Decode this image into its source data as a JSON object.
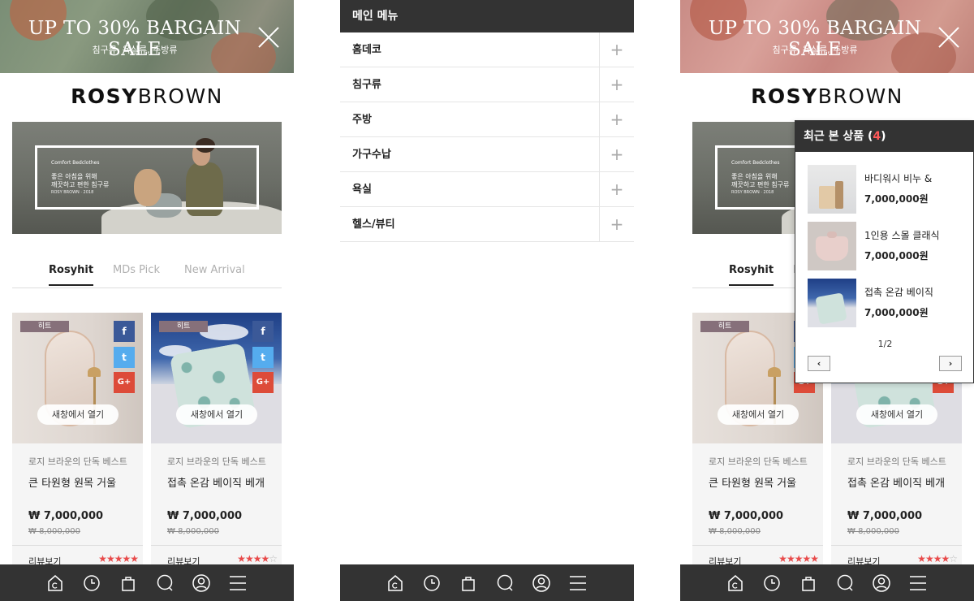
{
  "promo": {
    "title": "UP TO 30% BARGAIN SALE",
    "subtitle": "침구류, 욕실류, 주방류"
  },
  "logo": {
    "bold": "ROSY",
    "light": "BROWN"
  },
  "hero": {
    "small": "Comfort Bedclothes",
    "line1": "좋은 아침을 위해",
    "line2": "깨끗하고 편한 침구류",
    "tiny": "ROSY BROWN · 2018"
  },
  "tabs": [
    {
      "label": "Rosyhit"
    },
    {
      "label": "MDs Pick"
    },
    {
      "label": "New Arrival"
    }
  ],
  "products": [
    {
      "badge": "히트",
      "tag": "로지 브라운의 단독 베스트",
      "name": "큰 타원형 원목 거울",
      "price": "₩ 7,000,000",
      "original_price": "₩ 8,000,000",
      "review_label": "리뷰보기",
      "rating": 5,
      "rating_max": 5
    },
    {
      "badge": "히트",
      "tag": "로지 브라운의 단독 베스트",
      "name": "접촉 온감 베이직 베개",
      "price": "₩ 7,000,000",
      "original_price": "₩ 8,000,000",
      "review_label": "리뷰보기",
      "rating": 4,
      "rating_max": 5
    }
  ],
  "open_new_window": "새창에서 열기",
  "social": {
    "facebook": "f",
    "twitter": "t",
    "google": "G+"
  },
  "bottom_nav": {
    "icons": [
      "home-icon",
      "clock-icon",
      "bag-icon",
      "chat-icon",
      "user-icon",
      "menu-icon"
    ]
  },
  "menu": {
    "title": "메인 메뉴",
    "items": [
      {
        "label": "홈데코"
      },
      {
        "label": "침구류"
      },
      {
        "label": "주방"
      },
      {
        "label": "가구수납"
      },
      {
        "label": "욕실"
      },
      {
        "label": "헬스/뷰티"
      }
    ],
    "expand_symbol": "+"
  },
  "recent": {
    "title": "최근 본 상품 (",
    "count": "4",
    "close_paren": ")",
    "items": [
      {
        "name": "바디워시 비누 &",
        "price": "7,000,000원"
      },
      {
        "name": "1인용 스몰 클래식",
        "price": "7,000,000원"
      },
      {
        "name": "접촉 온감 베이직",
        "price": "7,000,000원"
      }
    ],
    "pager": "1/2",
    "prev": "‹",
    "next": "›"
  },
  "colors": {
    "dark": "#333333",
    "badge": "#86707a",
    "star": "#e84a4a",
    "facebook": "#3b5998",
    "twitter": "#55acee",
    "google": "#dd4b39"
  }
}
